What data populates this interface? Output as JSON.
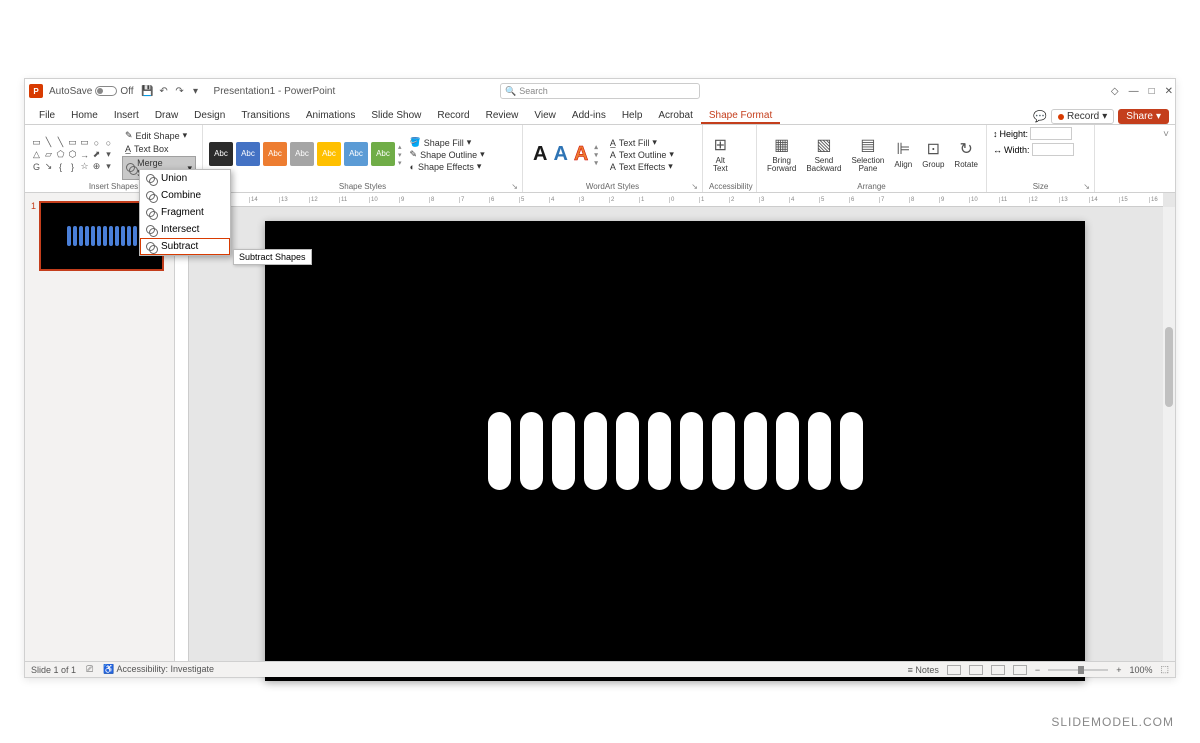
{
  "titlebar": {
    "autosave_label": "AutoSave",
    "autosave_state": "Off",
    "doc_title": "Presentation1 - PowerPoint",
    "search_placeholder": "Search"
  },
  "tabs": {
    "items": [
      "File",
      "Home",
      "Insert",
      "Draw",
      "Design",
      "Transitions",
      "Animations",
      "Slide Show",
      "Record",
      "Review",
      "View",
      "Add-ins",
      "Help",
      "Acrobat",
      "Shape Format"
    ],
    "record_label": "Record",
    "share_label": "Share"
  },
  "ribbon": {
    "insert_shapes": {
      "edit_shape": "Edit Shape",
      "text_box": "Text Box",
      "merge_shapes": "Merge Shapes",
      "group_label": "Insert Shapes"
    },
    "shape_styles": {
      "swatch_text": "Abc",
      "shape_fill": "Shape Fill",
      "shape_outline": "Shape Outline",
      "shape_effects": "Shape Effects",
      "group_label": "Shape Styles"
    },
    "wordart": {
      "text_fill": "Text Fill",
      "text_outline": "Text Outline",
      "text_effects": "Text Effects",
      "group_label": "WordArt Styles"
    },
    "accessibility": {
      "alt_text": "Alt\nText",
      "group_label": "Accessibility"
    },
    "arrange": {
      "bring_forward": "Bring\nForward",
      "send_backward": "Send\nBackward",
      "selection_pane": "Selection\nPane",
      "align": "Align",
      "group": "Group",
      "rotate": "Rotate",
      "group_label": "Arrange"
    },
    "size": {
      "height": "Height:",
      "width": "Width:",
      "group_label": "Size"
    }
  },
  "merge_menu": {
    "union": "Union",
    "combine": "Combine",
    "fragment": "Fragment",
    "intersect": "Intersect",
    "subtract": "Subtract",
    "tooltip": "Subtract Shapes"
  },
  "thumbnail": {
    "number": "1"
  },
  "statusbar": {
    "slide_info": "Slide 1 of 1",
    "accessibility": "Accessibility: Investigate",
    "notes": "Notes",
    "zoom": "100%"
  },
  "watermark": "SLIDEMODEL.COM"
}
